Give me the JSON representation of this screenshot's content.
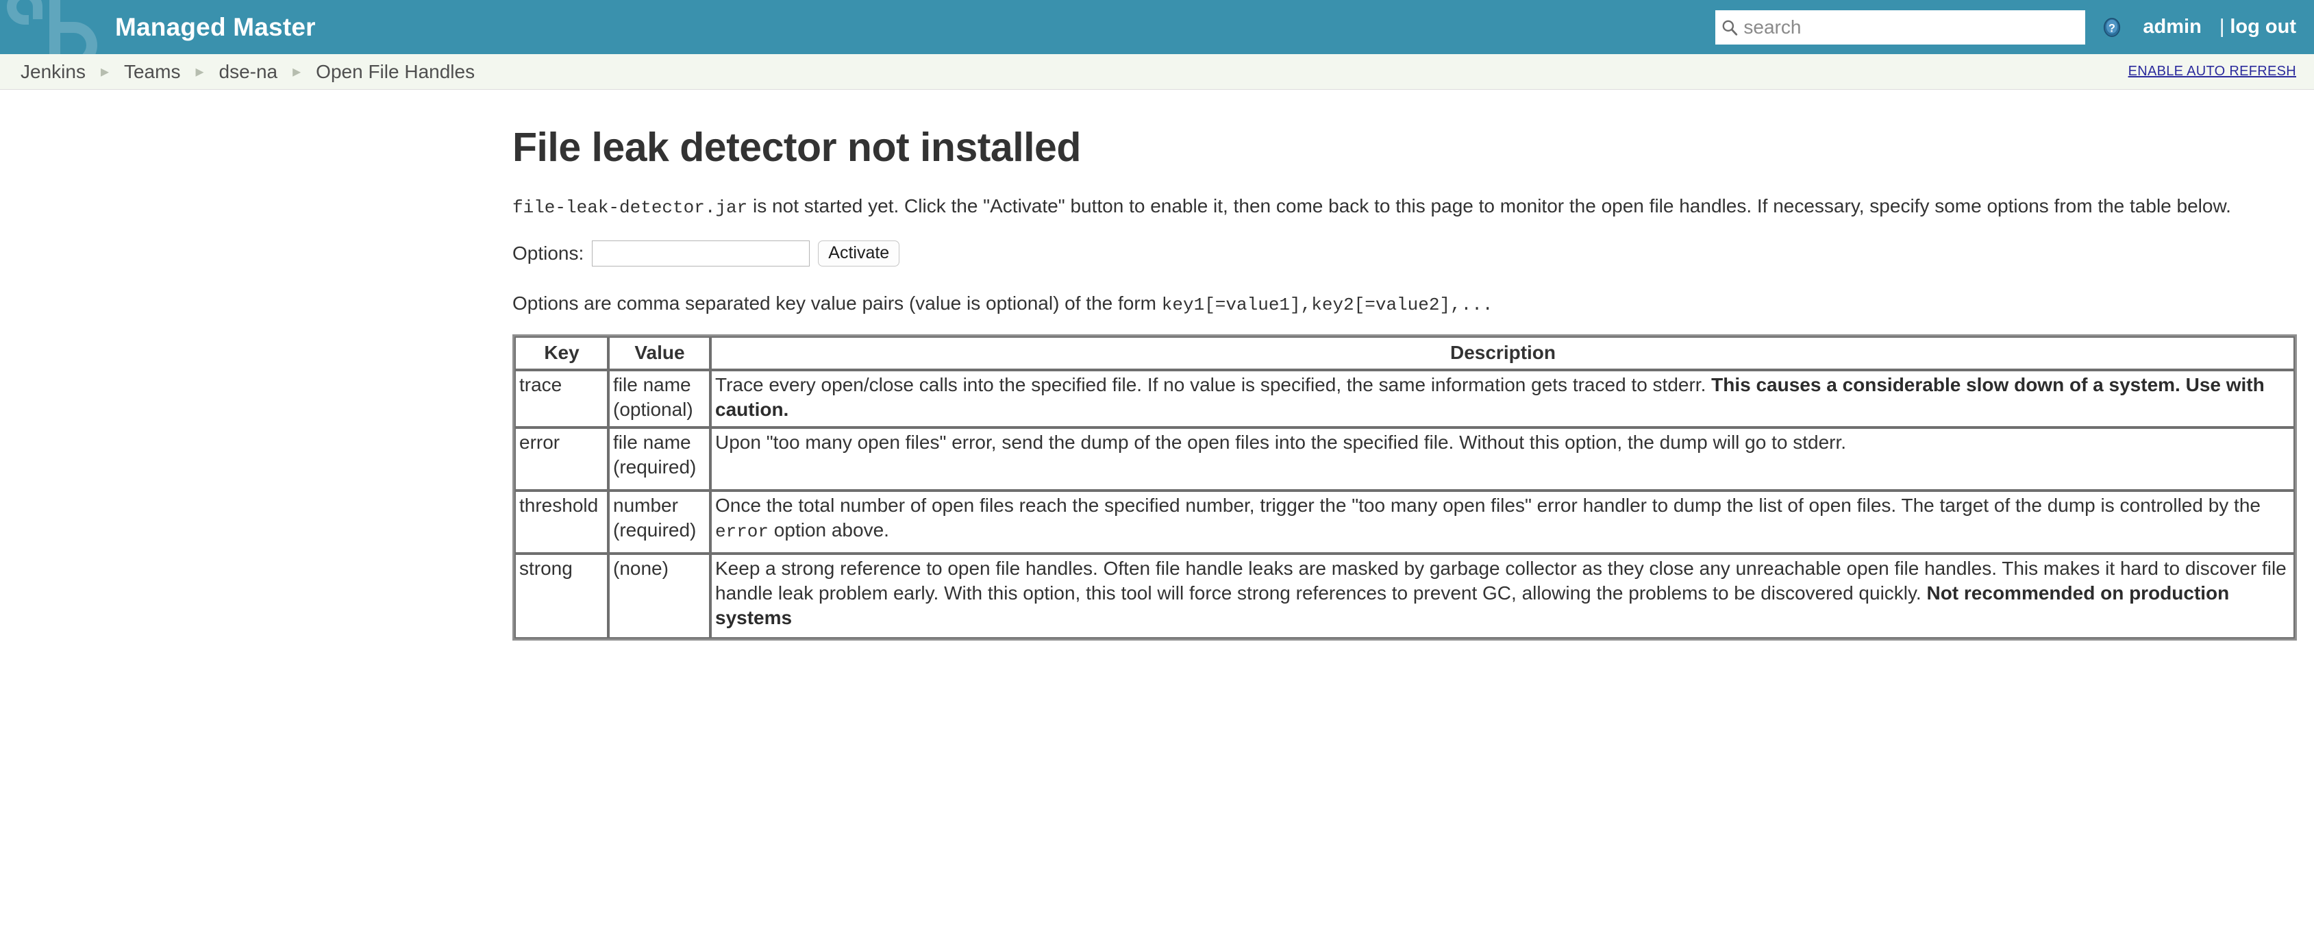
{
  "header": {
    "brand_title": "Managed Master",
    "logo_icon": "jenkins-logo-icon",
    "search": {
      "icon": "search-icon",
      "placeholder": "search",
      "value": ""
    },
    "help_icon": "help-question-icon",
    "user_name": "admin",
    "separator": "|",
    "log_out_label": "log out"
  },
  "breadcrumb": {
    "items": [
      {
        "label": "Jenkins"
      },
      {
        "label": "Teams"
      },
      {
        "label": "dse-na"
      },
      {
        "label": "Open File Handles"
      }
    ],
    "separator_icon": "chevron-right-icon",
    "auto_refresh_label": "ENABLE AUTO REFRESH"
  },
  "main": {
    "title": "File leak detector not installed",
    "intro": {
      "jar_name": "file-leak-detector.jar",
      "text": " is not started yet. Click the \"Activate\" button to enable it, then come back to this page to monitor the open file handles. If necessary, specify some options from the table below."
    },
    "options_form": {
      "label": "Options:",
      "input_value": "",
      "input_placeholder": "",
      "activate_label": "Activate"
    },
    "form_note": {
      "text": "Options are comma separated key value pairs (value is optional) of the form ",
      "code": "key1[=value1],key2[=value2],..."
    },
    "table": {
      "columns": [
        "Key",
        "Value",
        "Description"
      ],
      "rows": [
        {
          "key": "trace",
          "value": "file name (optional)",
          "description_plain": "Trace every open/close calls into the specified file. If no value is specified, the same information gets traced to stderr. ",
          "description_bold": "This causes a considerable slow down of a system. Use with caution.",
          "description_tail": ""
        },
        {
          "key": "error",
          "value": "file name (required)",
          "description_plain": "Upon \"too many open files\" error, send the dump of the open files into the specified file. Without this option, the dump will go to stderr.",
          "description_bold": "",
          "description_tail": ""
        },
        {
          "key": "threshold",
          "value": "number (required)",
          "description_plain": "Once the total number of open files reach the specified number, trigger the \"too many open files\" error handler to dump the list of open files. The target of the dump is controlled by the ",
          "description_code": "error",
          "description_tail": " option above."
        },
        {
          "key": "strong",
          "value": "(none)",
          "description_plain": "Keep a strong reference to open file handles. Often file handle leaks are masked by garbage collector as they close any unreachable open file handles. This makes it hard to discover file handle leak problem early. With this option, this tool will force strong references to prevent GC, allowing the problems to be discovered quickly. ",
          "description_bold": "Not recommended on production systems",
          "description_tail": ""
        }
      ]
    }
  },
  "colors": {
    "header_bg": "#3a91ad",
    "breadcrumb_bg": "#f3f7ef",
    "link": "#2b2b9c",
    "text": "#333333"
  }
}
